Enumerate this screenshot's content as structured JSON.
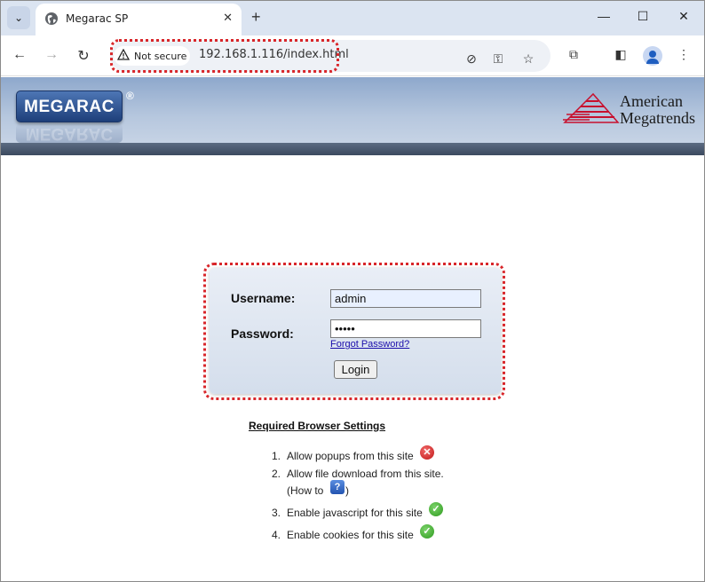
{
  "browser": {
    "tab_title": "Megarac SP",
    "security_label": "Not secure",
    "url": "192.168.1.116/index.html",
    "tab_menu_icon": "chevron-down-icon",
    "close_icon": "close-icon",
    "new_tab_icon": "plus-icon"
  },
  "header": {
    "product_logo": "MEGARAC",
    "registered_mark": "®",
    "vendor_line1": "American",
    "vendor_line2": "Megatrends"
  },
  "login": {
    "username_label": "Username:",
    "username_value": "admin",
    "password_label": "Password:",
    "password_value": "•••••",
    "forgot_link": "Forgot Password?",
    "login_button": "Login"
  },
  "settings": {
    "title": "Required Browser Settings",
    "items": [
      {
        "num": "1.",
        "text": "Allow popups from this site",
        "status": "error"
      },
      {
        "num": "2.",
        "text": "Allow file download from this site.",
        "subtext_before": "(How to",
        "subtext_after": ")",
        "status": "help"
      },
      {
        "num": "3.",
        "text": "Enable javascript for this site",
        "status": "ok"
      },
      {
        "num": "4.",
        "text": "Enable cookies for this site",
        "status": "ok"
      }
    ]
  },
  "colors": {
    "highlight": "#d8262a",
    "header_top": "#8ea8cc",
    "logo_blue": "#1e3f7a",
    "link": "#1a0dab"
  }
}
